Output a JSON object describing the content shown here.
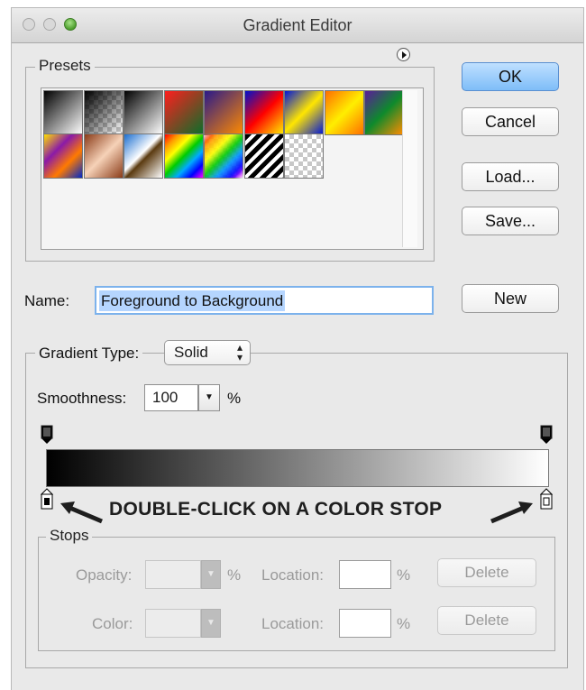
{
  "window": {
    "title": "Gradient Editor"
  },
  "presets": {
    "legend": "Presets",
    "swatches": [
      {
        "name": "foreground-to-background",
        "style": "linear-gradient(135deg,#000 0%,#fff 100%)"
      },
      {
        "name": "foreground-to-transparent",
        "style": "checker-black"
      },
      {
        "name": "black-white",
        "style": "linear-gradient(135deg,#000 0%,#fff 100%)"
      },
      {
        "name": "red-green",
        "style": "linear-gradient(135deg,#ff1e1e 0%,#0a6e2a 100%)"
      },
      {
        "name": "violet-orange",
        "style": "linear-gradient(135deg,#2a1a8a 0%,#ff8a00 100%)"
      },
      {
        "name": "blue-red-yellow",
        "style": "linear-gradient(135deg,#0011cc 0%,#ff0000 50%,#ffee00 100%)"
      },
      {
        "name": "blue-yellow-blue",
        "style": "linear-gradient(135deg,#0015d8 0%,#ffe600 50%,#0015d8 100%)"
      },
      {
        "name": "orange-yellow-orange",
        "style": "linear-gradient(135deg,#ff6e00 0%,#ffee00 50%,#ff6e00 100%)"
      },
      {
        "name": "violet-green-orange",
        "style": "linear-gradient(135deg,#5a1c9a 0%,#0e8a2c 50%,#ff8c00 100%)"
      },
      {
        "name": "yellow-violet-orange-blue",
        "style": "linear-gradient(135deg,#ffe000 0%,#8a1aa8 35%,#ff7a00 65%,#0028c8 100%)"
      },
      {
        "name": "copper",
        "style": "linear-gradient(135deg,#8a3b18 0%,#f6d2b8 50%,#8a3b18 100%)"
      },
      {
        "name": "chrome",
        "style": "linear-gradient(135deg,#1c6fd0 0%,#ffffff 45%,#5b3a10 55%,#ffffff 100%)"
      },
      {
        "name": "spectrum",
        "style": "linear-gradient(135deg,#ff0000,#ff9900,#ffff00,#00cc00,#00aaff,#0000ff,#ff00ff)"
      },
      {
        "name": "transparent-rainbow",
        "style": "checker-rainbow"
      },
      {
        "name": "transparent-stripes",
        "style": "stripes"
      },
      {
        "name": "transparent",
        "style": "checker"
      }
    ]
  },
  "buttons": {
    "ok": "OK",
    "cancel": "Cancel",
    "load": "Load...",
    "save": "Save...",
    "new": "New"
  },
  "name": {
    "label": "Name:",
    "value": "Foreground to Background"
  },
  "gradient": {
    "type_label": "Gradient Type:",
    "type_value": "Solid",
    "smoothness_label": "Smoothness:",
    "smoothness_value": "100",
    "smoothness_unit": "%",
    "colors": [
      "#000000",
      "#ffffff"
    ]
  },
  "instruction": "DOUBLE-CLICK ON A COLOR STOP",
  "stops": {
    "legend": "Stops",
    "opacity_label": "Opacity:",
    "opacity_value": "",
    "opacity_unit": "%",
    "location_label_1": "Location:",
    "location_value_1": "",
    "location_unit_1": "%",
    "delete_1": "Delete",
    "color_label": "Color:",
    "location_label_2": "Location:",
    "location_value_2": "",
    "location_unit_2": "%",
    "delete_2": "Delete"
  }
}
